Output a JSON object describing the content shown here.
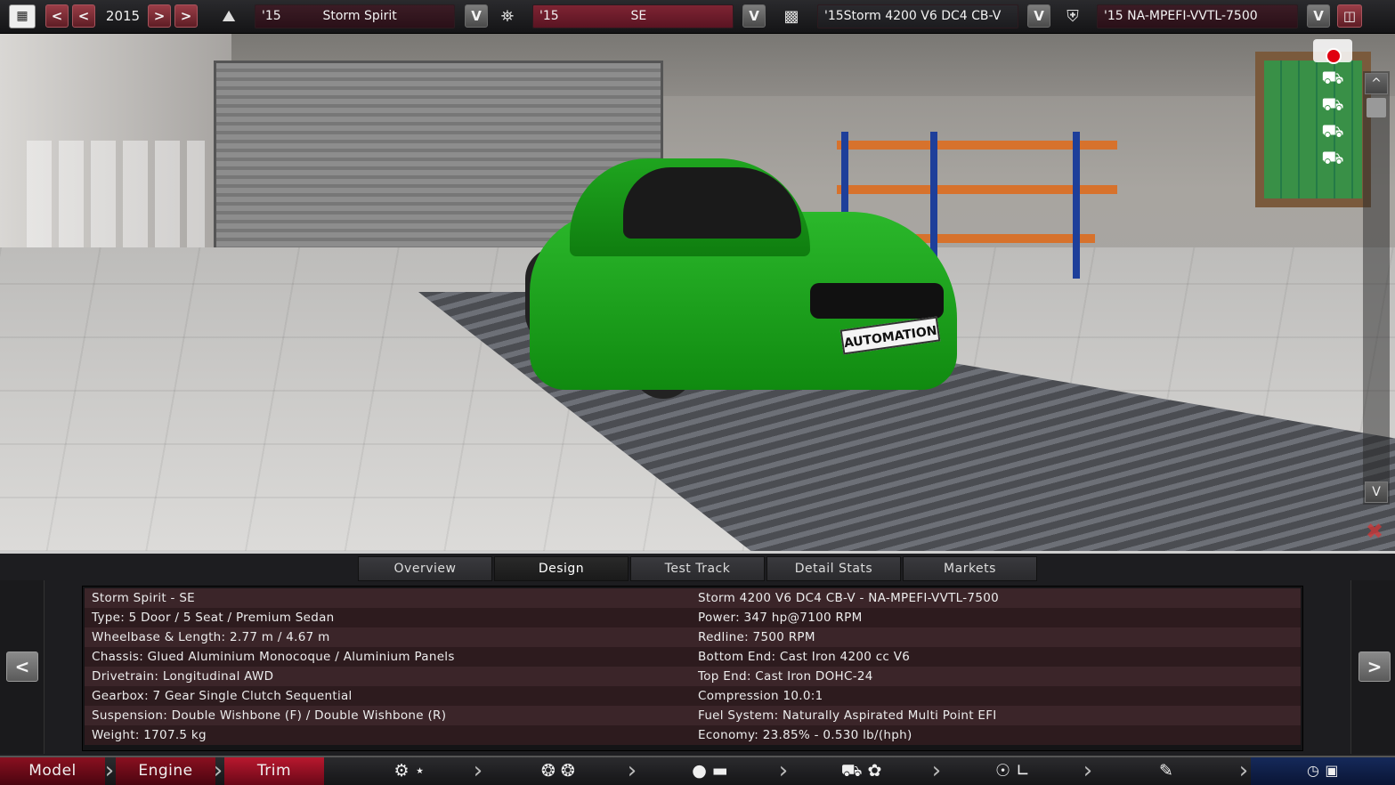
{
  "topbar": {
    "calendar_icon": "calendar-icon",
    "year": "2015",
    "model": {
      "year": "'15",
      "name": "Storm Spirit"
    },
    "trim": {
      "year": "'15",
      "name": "SE"
    },
    "engine_family": {
      "text": "'15Storm 4200 V6 DC4 CB-V"
    },
    "engine_variant": {
      "text": "'15  NA-MPEFI-VVTL-7500"
    },
    "prev_fast": "<",
    "prev": "<",
    "next": ">",
    "next_fast": ">",
    "dropdown": "V"
  },
  "scene": {
    "plate_text": "AUTOMATION",
    "scroll_up": "^",
    "scroll_down": "V"
  },
  "tabs": [
    "Overview",
    "Design",
    "Test Track",
    "Detail Stats",
    "Markets"
  ],
  "active_tab": "Design",
  "info": {
    "left": [
      "Storm Spirit - SE",
      "Type: 5 Door / 5 Seat / Premium Sedan",
      "Wheelbase & Length: 2.77 m / 4.67 m",
      "Chassis: Glued Aluminium Monocoque / Aluminium Panels",
      "Drivetrain: Longitudinal AWD",
      "Gearbox: 7 Gear Single Clutch Sequential",
      "Suspension: Double Wishbone (F) / Double Wishbone (R)",
      "Weight: 1707.5 kg"
    ],
    "right": [
      "Storm 4200 V6 DC4 CB-V - NA-MPEFI-VVTL-7500",
      "Power: 347 hp@7100 RPM",
      "Redline: 7500 RPM",
      "Bottom End: Cast Iron 4200 cc V6",
      "Top End: Cast Iron DOHC-24",
      "Compression 10.0:1",
      "Fuel System: Naturally Aspirated Multi Point EFI",
      "Economy: 23.85% - 0.530 lb/(hph)"
    ],
    "prev_arrow": "<",
    "next_arrow": ">"
  },
  "bottomnav": {
    "model": "Model",
    "engine": "Engine",
    "trim": "Trim"
  }
}
